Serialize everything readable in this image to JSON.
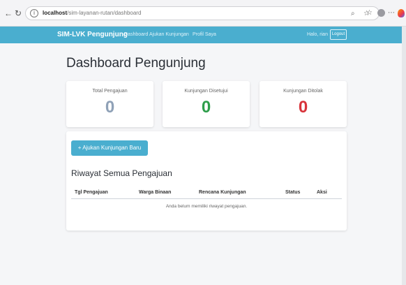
{
  "browser": {
    "back_icon": "back-arrow-icon",
    "reload_icon": "reload-icon",
    "url_host": "localhost",
    "url_path": "/sim-layanan-rutan/dashboard",
    "zoom_icon": "zoom-icon",
    "star_icon": "star-icon",
    "collections_icon": "collections-icon",
    "more_icon": "more-icon"
  },
  "navbar": {
    "brand": "SIM-LVK Pengunjung",
    "links": [
      "Dashboard",
      "Ajukan Kunjungan",
      "Profil Saya"
    ],
    "greeting": "Halo, rian",
    "logout": "Logout",
    "color": "#4aaecf"
  },
  "page": {
    "title": "Dashboard Pengunjung"
  },
  "stats": [
    {
      "label": "Total Pengajuan",
      "value": "0",
      "color": "#8fa1b7"
    },
    {
      "label": "Kunjungan Disetujui",
      "value": "0",
      "color": "#2e9e4b"
    },
    {
      "label": "Kunjungan Ditolak",
      "value": "0",
      "color": "#d8343b"
    }
  ],
  "panel": {
    "add_button": "+ Ajukan Kunjungan Baru",
    "section_title": "Riwayat Semua Pengajuan",
    "columns": [
      "Tgl Pengajuan",
      "Warga Binaan",
      "Rencana Kunjungan",
      "Status",
      "Aksi"
    ],
    "empty_message": "Anda belum memiliki riwayat pengajuan."
  }
}
